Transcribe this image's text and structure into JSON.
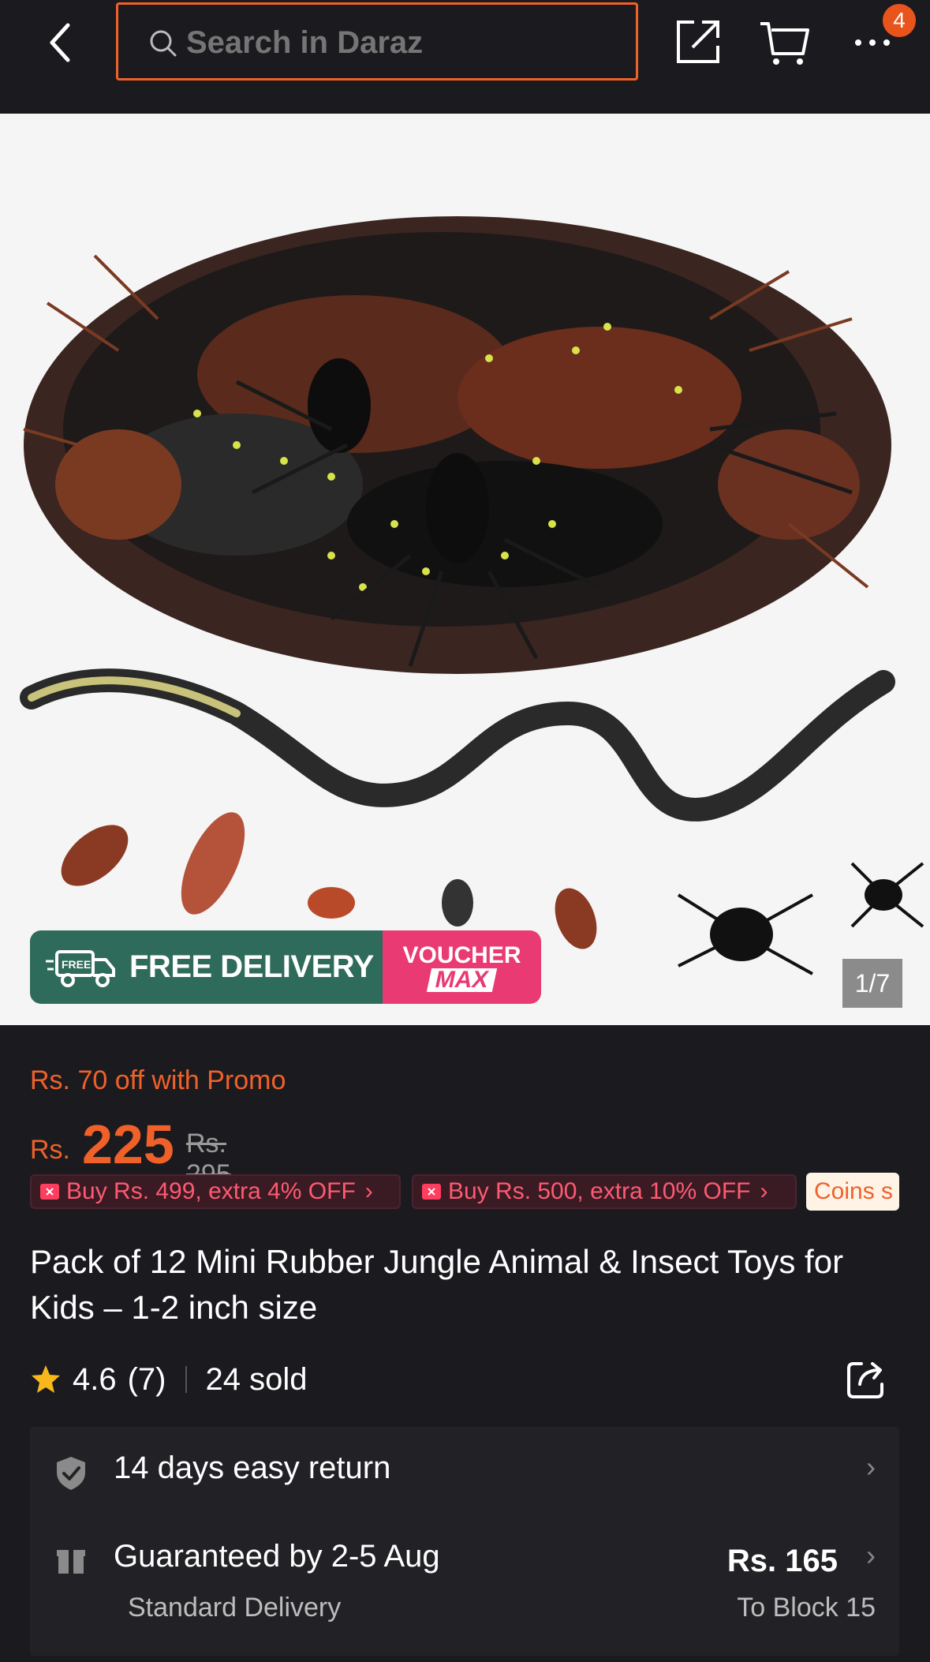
{
  "header": {
    "search_placeholder": "Search in Daraz",
    "cart_badge": "4"
  },
  "gallery": {
    "free_delivery_badge_small": "FREE",
    "free_delivery": "FREE DELIVERY",
    "voucher_line1": "VOUCHER",
    "voucher_line2": "MAX",
    "page_indicator": "1/7"
  },
  "pricing": {
    "promo_text": "Rs. 70 off with Promo",
    "currency": "Rs.",
    "price": "225",
    "original_price": "Rs. 295",
    "offers": [
      {
        "label": "Buy Rs. 499, extra 4% OFF"
      },
      {
        "label": "Buy Rs. 500, extra 10% OFF"
      }
    ],
    "coins_label": "Coins s"
  },
  "product": {
    "title": "Pack of 12 Mini Rubber Jungle Animal & Insect Toys for Kids – 1-2 inch size",
    "rating": "4.6",
    "rating_count": "(7)",
    "sold": "24 sold"
  },
  "services": {
    "return_text": "14 days easy return",
    "delivery_title": "Guaranteed by 2-5 Aug",
    "delivery_type": "Standard Delivery",
    "delivery_price": "Rs. 165",
    "delivery_to": "To Block 15"
  },
  "colors": {
    "accent": "#f0612a",
    "background": "#1b1b1f",
    "offer_pink": "#ff5a73",
    "free_green": "#2f6b5a",
    "voucher_pink": "#e93a73"
  }
}
